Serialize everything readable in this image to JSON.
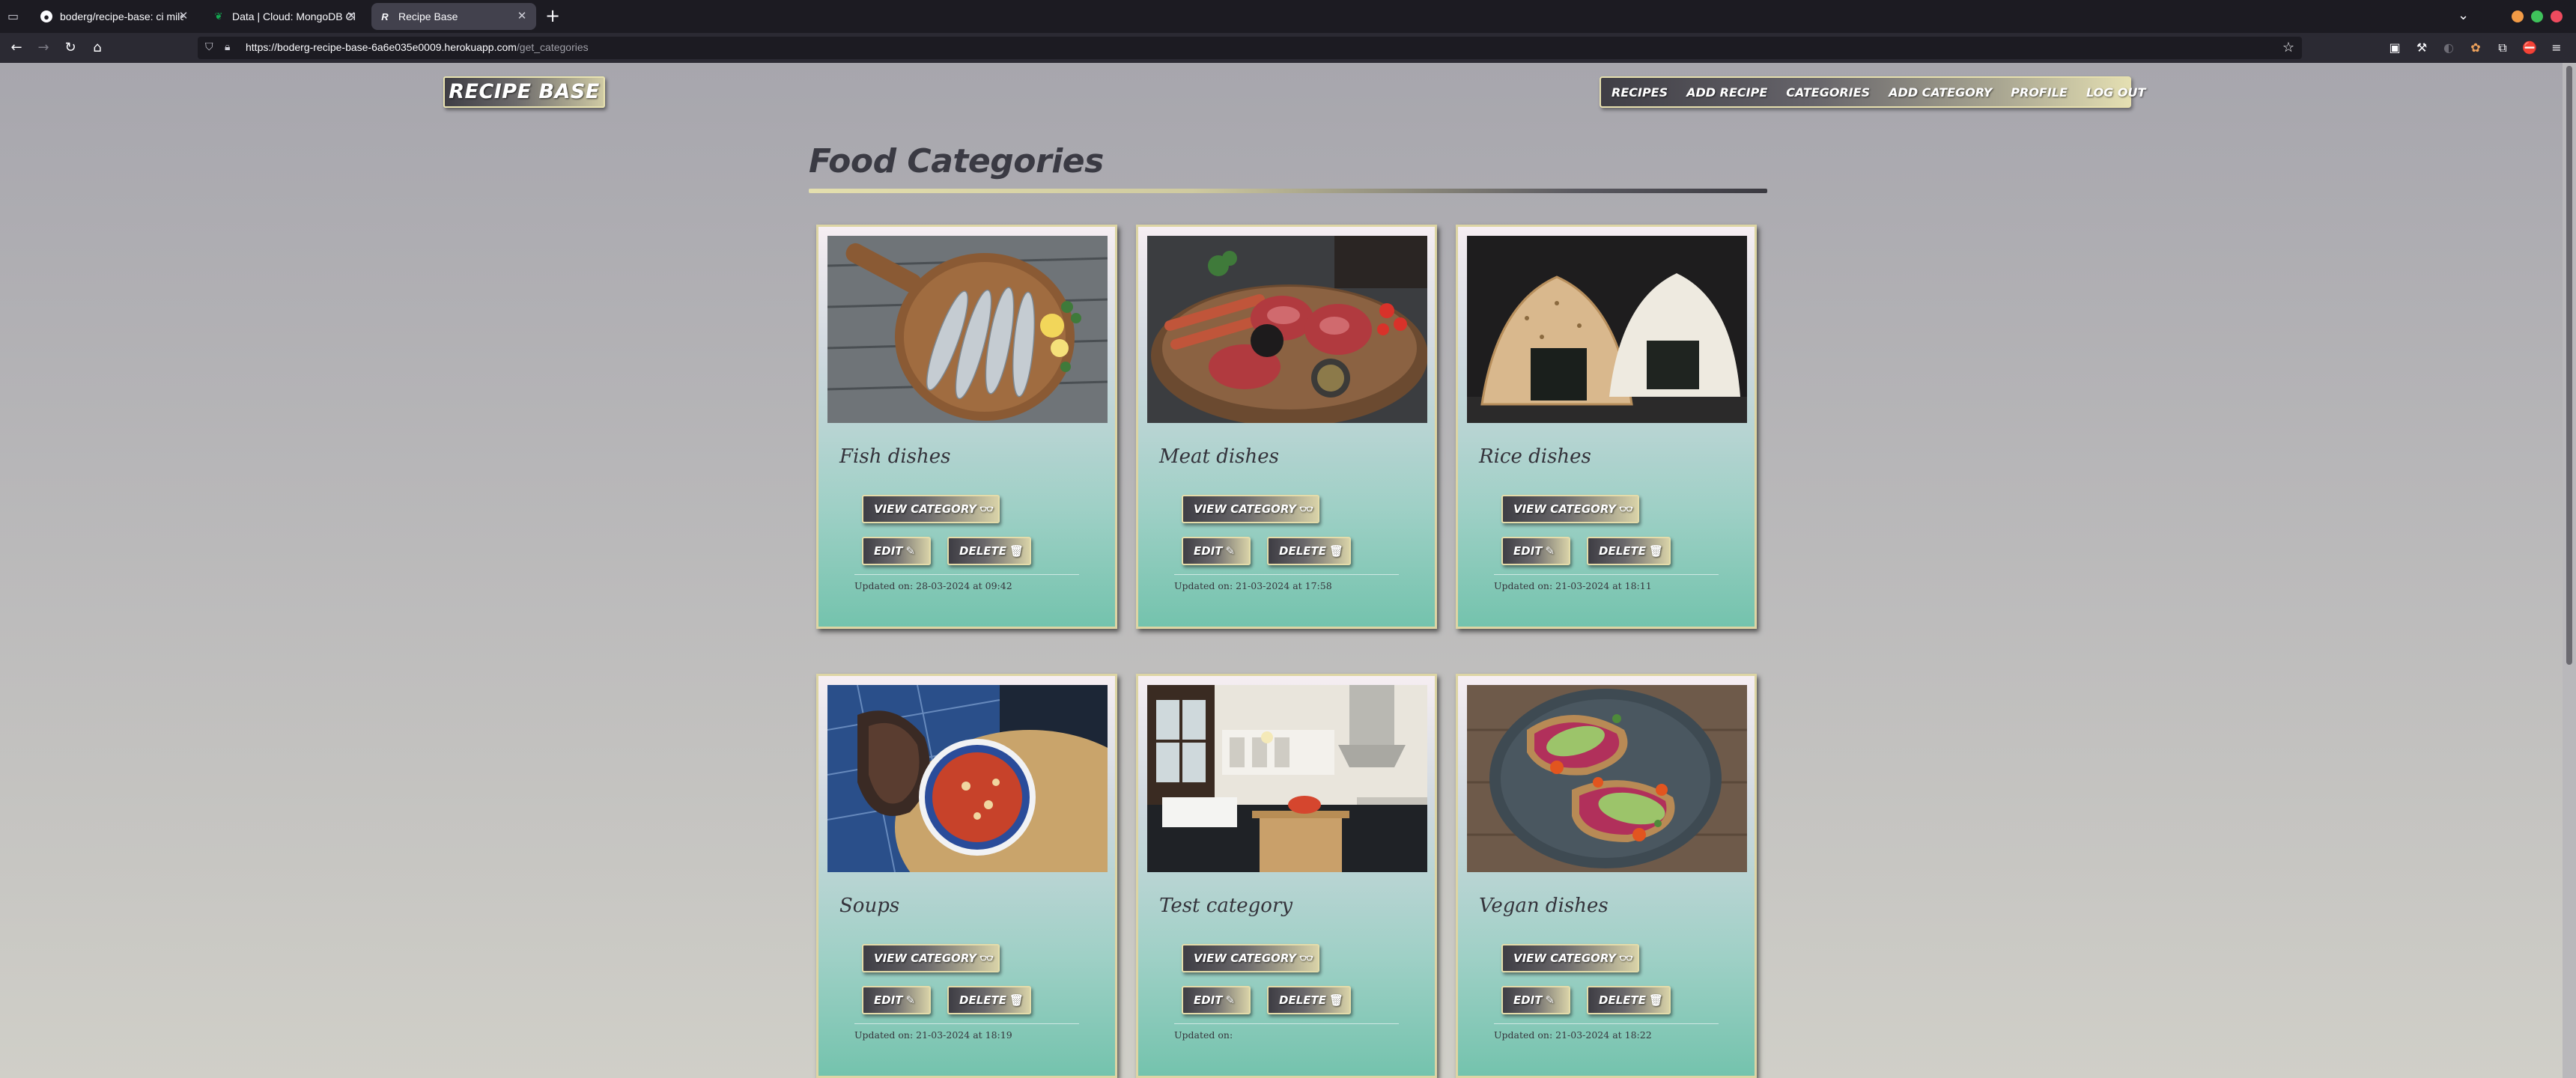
{
  "browser": {
    "tabs": [
      {
        "title": "boderg/recipe-base: ci mile",
        "icon": "github-icon",
        "active": false
      },
      {
        "title": "Data | Cloud: MongoDB Clo",
        "icon": "mongodb-leaf-icon",
        "active": false
      },
      {
        "title": "Recipe Base",
        "icon": "recipe-base-favicon",
        "active": true
      }
    ],
    "favicon_letter": "R",
    "url_host": "https://boderg-recipe-base-6a6e035e0009.herokuapp.com",
    "url_path": "/get_categories"
  },
  "site": {
    "logo": "RECIPE BASE",
    "menu": [
      "RECIPES",
      "ADD RECIPE",
      "CATEGORIES",
      "ADD CATEGORY",
      "PROFILE",
      "LOG OUT"
    ]
  },
  "page_title": "Food Categories",
  "labels": {
    "view": "VIEW CATEGORY",
    "edit": "EDIT",
    "delete": "DELETE",
    "updated_prefix": "Updated on:"
  },
  "categories": [
    {
      "name": "Fish dishes",
      "updated": "Updated on: 28-03-2024 at 09:42",
      "photo": "fish-photo"
    },
    {
      "name": "Meat dishes",
      "updated": "Updated on: 21-03-2024 at 17:58",
      "photo": "meat-photo"
    },
    {
      "name": "Rice dishes",
      "updated": "Updated on: 21-03-2024 at 18:11",
      "photo": "rice-photo"
    },
    {
      "name": "Soups",
      "updated": "Updated on: 21-03-2024 at 18:19",
      "photo": "soup-photo"
    },
    {
      "name": "Test category",
      "updated": "Updated on:",
      "photo": "kitchen-photo"
    },
    {
      "name": "Vegan dishes",
      "updated": "Updated on: 21-03-2024 at 18:22",
      "photo": "vegan-photo"
    }
  ],
  "colors": {
    "chrome_dark": "#1c1b22",
    "accent_gold": "#e4dcaa",
    "card_mint": "#74c3ad",
    "title_text": "#3a3a43"
  }
}
